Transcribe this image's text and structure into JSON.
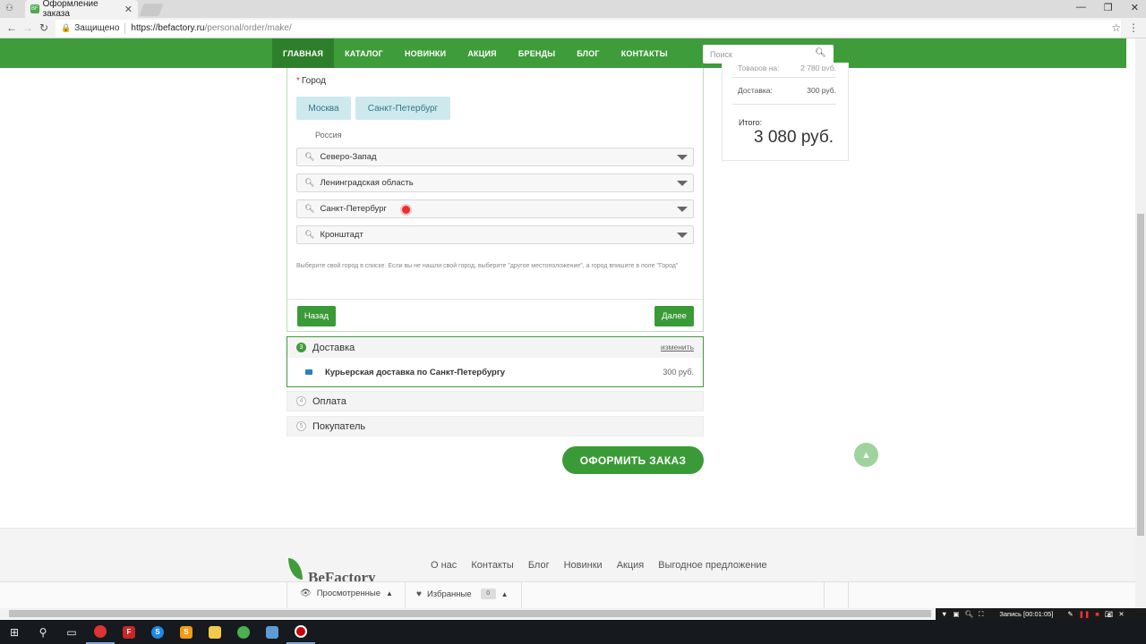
{
  "browser": {
    "tab_title": "Оформление заказа",
    "tab_favicon": "BF",
    "secure_label": "Защищено",
    "url_host": "https://befactory.ru",
    "url_path": "/personal/order/make/"
  },
  "nav": {
    "items": [
      "ГЛАВНАЯ",
      "КАТАЛОГ",
      "НОВИНКИ",
      "АКЦИЯ",
      "БРЕНДЫ",
      "БЛОГ",
      "КОНТАКТЫ"
    ],
    "search_placeholder": "Поиск"
  },
  "location": {
    "city_label": "Город",
    "city_buttons": [
      "Москва",
      "Санкт-Петербург"
    ],
    "country": "Россия",
    "selects": [
      "Северо-Запад",
      "Ленинградская область",
      "Санкт-Петербург",
      "Кронштадт"
    ],
    "hint": "Выберите свой город в списке. Если вы не нашли свой город, выберите \"другое местоположение\", а город впишите в поле \"Город\"",
    "back_label": "Назад",
    "next_label": "Далее"
  },
  "steps": {
    "delivery": {
      "num": "3",
      "title": "Доставка",
      "change": "изменить",
      "option": "Курьерская доставка по Санкт-Петербургу",
      "price": "300 руб."
    },
    "payment": {
      "num": "4",
      "title": "Оплата"
    },
    "buyer": {
      "num": "5",
      "title": "Покупатель"
    }
  },
  "order_button": "ОФОРМИТЬ ЗАКАЗ",
  "totals": {
    "goods_label": "Товаров на:",
    "goods_value": "2 780 руб.",
    "delivery_label": "Доставка:",
    "delivery_value": "300 руб.",
    "total_label": "Итого:",
    "total_value": "3 080 руб."
  },
  "footer": {
    "logo": "BeFactory",
    "links": [
      "О нас",
      "Контакты",
      "Блог",
      "Новинки",
      "Акция",
      "Выгодное предложение"
    ],
    "viewed_label": "Просмотренные",
    "favorites_label": "Избранные",
    "favorites_count": "0"
  },
  "recorder": {
    "label": "Запись [00:01:05]"
  },
  "colors": {
    "brand_green": "#3e9c3a",
    "city_button_bg": "#cde9ee"
  }
}
